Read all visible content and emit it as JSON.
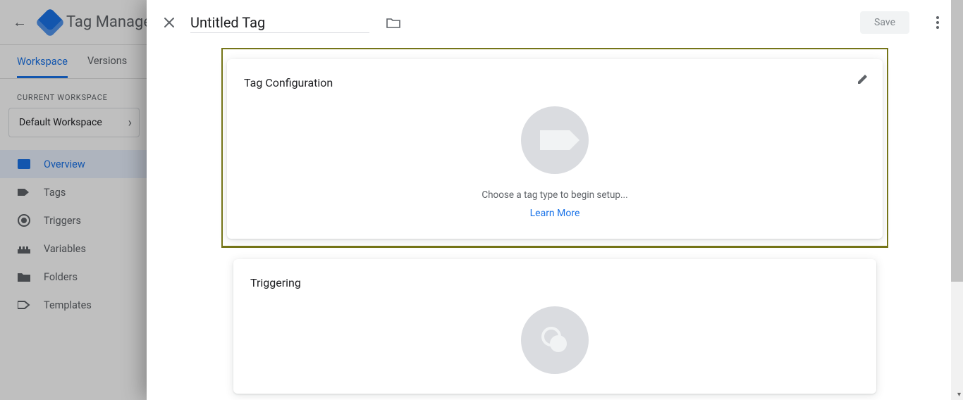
{
  "background": {
    "back_icon": "arrow-left",
    "app_name": "Tag Manager",
    "tabs": {
      "workspace": "Workspace",
      "versions": "Versions"
    },
    "workspace_section_label": "CURRENT WORKSPACE",
    "workspace_name": "Default Workspace",
    "sidebar": {
      "overview": "Overview",
      "tags": "Tags",
      "triggers": "Triggers",
      "variables": "Variables",
      "folders": "Folders",
      "templates": "Templates"
    }
  },
  "panel": {
    "title": "Untitled Tag",
    "save_label": "Save",
    "tag_config": {
      "heading": "Tag Configuration",
      "empty_text": "Choose a tag type to begin setup...",
      "learn_more": "Learn More"
    },
    "triggering": {
      "heading": "Triggering"
    }
  }
}
